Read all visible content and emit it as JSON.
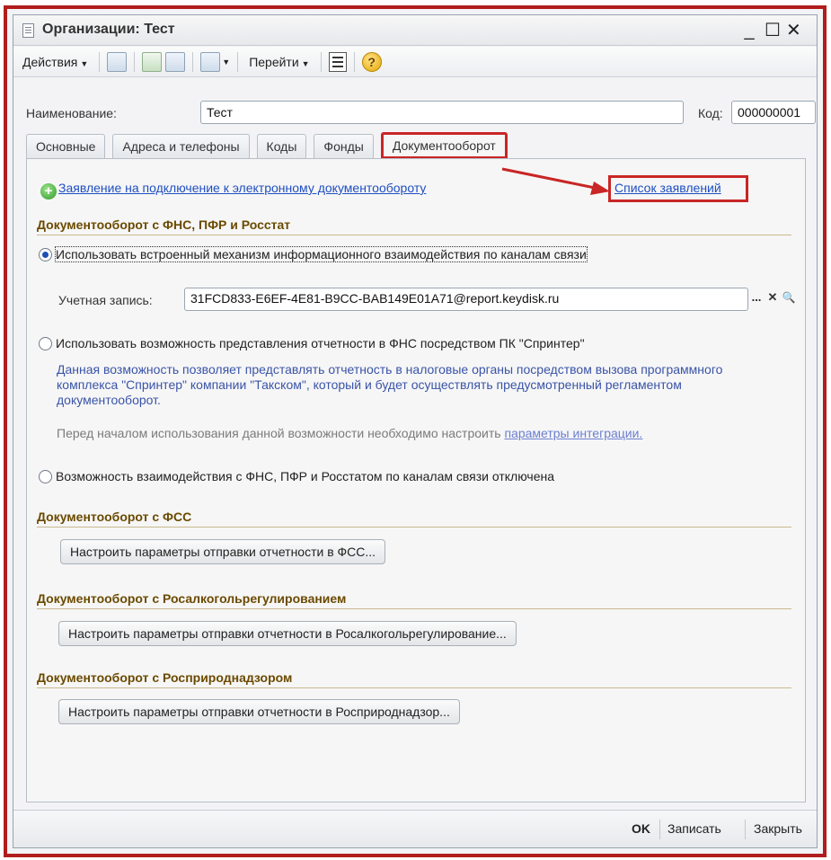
{
  "window": {
    "title": "Организации: Тест",
    "controls": [
      "_",
      "☐",
      "✕"
    ]
  },
  "toolbar": {
    "actions_label": "Действия",
    "goto_label": "Перейти",
    "help_glyph": "?"
  },
  "form": {
    "name_label": "Наименование:",
    "name_value": "Тест",
    "code_label": "Код:",
    "code_value": "000000001"
  },
  "tabs": [
    {
      "label": "Основные",
      "active": false
    },
    {
      "label": "Адреса и телефоны",
      "active": false
    },
    {
      "label": "Коды",
      "active": false
    },
    {
      "label": "Фонды",
      "active": false
    },
    {
      "label": "Документооборот",
      "active": true
    }
  ],
  "panel": {
    "application_link": "Заявление на подключение к электронному документообороту",
    "list_link": "Список заявлений",
    "section_fns": "Документооборот с ФНС, ПФР и Росстат",
    "radio_builtin": "Использовать встроенный механизм информационного взаимодействия по каналам связи",
    "account_label": "Учетная запись:",
    "account_value": "31FCD833-E6EF-4E81-B9CC-BAB149E01A71@report.keydisk.ru",
    "account_btn_select": "...",
    "account_btn_clear": "✕",
    "account_btn_open": "🔍",
    "radio_sprinter": "Использовать возможность представления отчетности в ФНС посредством ПК \"Спринтер\"",
    "sprinter_desc": "Данная возможность позволяет представлять отчетность в налоговые органы посредством вызова программного комплекса \"Спринтер\" компании \"Такском\", который и будет осуществлять предусмотренный регламентом документооборот.",
    "sprinter_note": "Перед началом использования данной возможности необходимо настроить",
    "sprinter_note_link": "параметры интеграции.",
    "radio_disabled": "Возможность взаимодействия с ФНС, ПФР и Росстатом по каналам связи отключена",
    "section_fss": "Документооборот с ФСС",
    "btn_fss": "Настроить параметры отправки отчетности в ФСС...",
    "section_alco": "Документооборот с Росалкогольрегулированием",
    "btn_alco": "Настроить параметры отправки отчетности в Росалкогольрегулирование...",
    "section_nature": "Документооборот с Росприроднадзором",
    "btn_nature": "Настроить параметры отправки отчетности в Росприроднадзор..."
  },
  "footer": {
    "ok": "OK",
    "save": "Записать",
    "close": "Закрыть"
  },
  "colors": {
    "highlight": "#c92626",
    "section_text": "#6b4a00",
    "link": "#1f4fc2"
  },
  "radio_selected": "builtin"
}
